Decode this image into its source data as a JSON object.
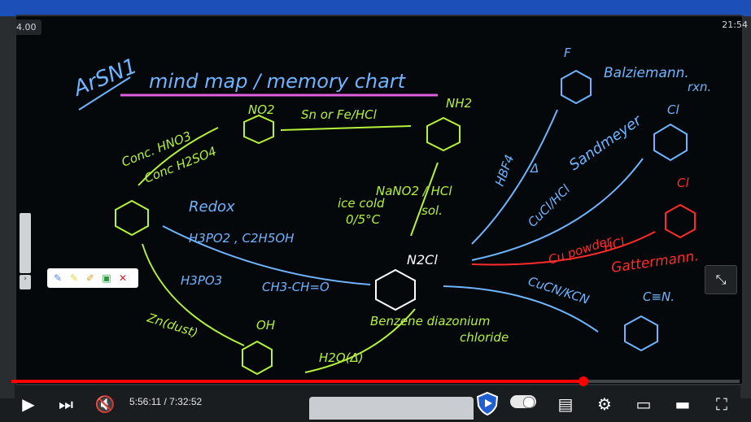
{
  "player": {
    "speed_badge": "4.00",
    "clock": "21:54",
    "current_time": "5:56:11",
    "duration": "7:32:52",
    "time_display": "5:56:11 / 7:32:52",
    "progress_fraction": 0.786,
    "colors": {
      "accent": "#ff0000",
      "background": "#0b0d0e"
    }
  },
  "board": {
    "corner_note": "ArSN1",
    "title": "mind map / memory chart",
    "labels": {
      "no2": "NO2",
      "nh2": "NH2",
      "sn_fe": "Sn or Fe/HCl",
      "conc_hno3": "Conc. HNO3",
      "conc_h2so4": "Conc H2SO4",
      "redox": "Redox",
      "h3po2": "H3PO2 ,  C2H5OH",
      "h3po3": "H3PO3",
      "ch3cho": "CH3-CH=O",
      "nano2": "NaNO2 / HCl",
      "ice_cold": "ice cold",
      "temp": "0/5°C",
      "sol": "sol.",
      "n2cl": "N2Cl",
      "diazonium": "Benzene diazonium",
      "chloride": "chloride",
      "zn_dust": "Zn(dust)",
      "oh": "OH",
      "h2o": "H2O(Δ)",
      "hbf4": "HBF4",
      "delta": "Δ",
      "f": "F",
      "balz": "Balziemann.",
      "rxn": "rxn.",
      "cucl_hcl": "CuCl/HCl",
      "sandmeyer": "Sandmeyer",
      "cl_top": "Cl",
      "cl_red": "Cl",
      "cu_powder": "Cu powder",
      "hcl_red": "HCl",
      "gattermann": "Gattermann.",
      "cucn": "CuCN/KCN",
      "cn": "C≡N."
    }
  },
  "toolbar": {
    "icons": [
      "pen-icon",
      "highlighter-icon",
      "brush-icon",
      "save-icon",
      "close-icon"
    ]
  },
  "controls": {
    "play": "play",
    "next": "next",
    "mute": "mute",
    "settings": "settings",
    "miniplayer": "miniplayer",
    "theater": "theater",
    "fullscreen": "fullscreen"
  }
}
